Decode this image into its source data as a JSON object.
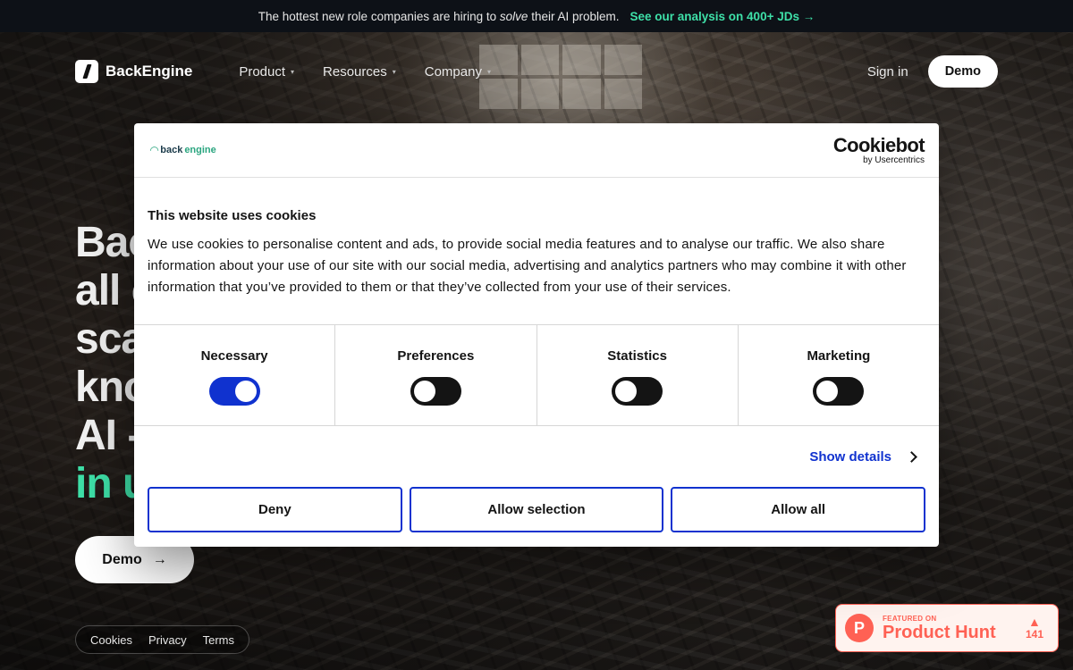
{
  "announcement": {
    "text_before": "The hottest new role companies are hiring to",
    "text_em": "solve",
    "text_after": "their AI problem.",
    "link": "See our analysis on 400+ JDs",
    "link_arrow": "→"
  },
  "nav": {
    "brand": "BackEngine",
    "menu": [
      {
        "label": "Product",
        "caret": "▾"
      },
      {
        "label": "Resources",
        "caret": "▾"
      },
      {
        "label": "Company",
        "caret": "▾"
      }
    ],
    "signin": "Sign in",
    "demo": "Demo"
  },
  "hero": {
    "lines": [
      "Bac",
      "all c",
      "sca",
      "kno",
      "AI -"
    ],
    "accent_line": "in u",
    "demo_label": "Demo",
    "demo_arrow": "→"
  },
  "footer": {
    "links": [
      "Cookies",
      "Privacy",
      "Terms"
    ]
  },
  "producthunt": {
    "logo": "P",
    "small": "FEATURED ON",
    "big": "Product Hunt",
    "arrow": "▲",
    "votes": "141"
  },
  "cookie": {
    "site_logo_prefix": "back",
    "site_logo_suffix": "engine",
    "cookiebot_main": "Cookiebot",
    "cookiebot_sub": "by Usercentrics",
    "title": "This website uses cookies",
    "text": "We use cookies to personalise content and ads, to provide social media features and to analyse our traffic. We also share information about your use of our site with our social media, advertising and analytics partners who may combine it with other information that you’ve provided to them or that they’ve collected from your use of their services.",
    "toggles": [
      {
        "label": "Necessary",
        "on": true
      },
      {
        "label": "Preferences",
        "on": false
      },
      {
        "label": "Statistics",
        "on": false
      },
      {
        "label": "Marketing",
        "on": false
      }
    ],
    "show_details": "Show details",
    "buttons": {
      "deny": "Deny",
      "allow_selection": "Allow selection",
      "allow_all": "Allow all"
    }
  },
  "colors": {
    "accent_green": "#3ee0a8",
    "cookie_blue": "#1032cf",
    "producthunt": "#ff6154"
  }
}
